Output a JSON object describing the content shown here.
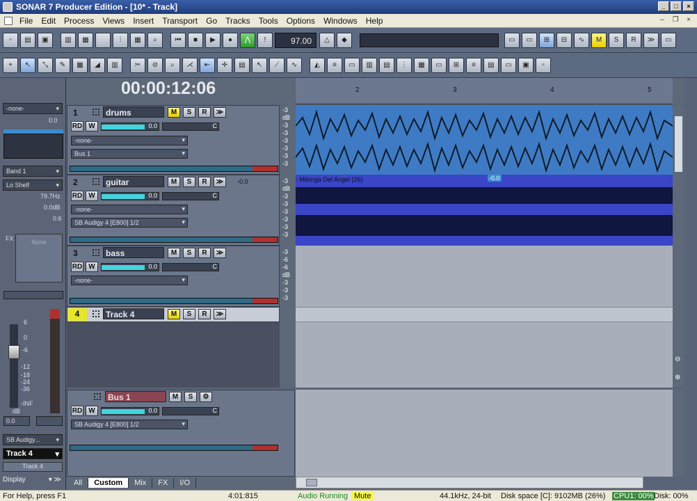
{
  "window": {
    "title": "SONAR 7 Producer Edition - [10* - Track]"
  },
  "menu": [
    "File",
    "Edit",
    "Process",
    "Views",
    "Insert",
    "Transport",
    "Go",
    "Tracks",
    "Tools",
    "Options",
    "Windows",
    "Help"
  ],
  "transport": {
    "tempo": "97.00",
    "time": "00:00:12:06"
  },
  "ruler": {
    "marks": [
      "2",
      "3",
      "4",
      "5"
    ]
  },
  "left_panel": {
    "top_select": "-none-",
    "top_value": "0.0",
    "eq_band": "Band 1",
    "eq_type": "Lo Shelf",
    "eq_freq": "79.7Hz",
    "eq_gain": "0.0dB",
    "eq_q": "0.6",
    "fx_label": "FX",
    "fx_none": "None",
    "fader_scale": [
      "6",
      "0",
      "-6",
      "-12",
      "-18",
      "-24",
      "-36",
      "-INF"
    ],
    "fader_value": "0.0",
    "db_label": "dB",
    "output": "SB Audigy...",
    "track_name_sel": "Track 4",
    "track_name": "Track 4",
    "display": "Display"
  },
  "tracks": [
    {
      "num": "1",
      "name": "drums",
      "vol": "0.0",
      "pan": "C",
      "input": "-none-",
      "output": "Bus 1",
      "mute_on": true
    },
    {
      "num": "2",
      "name": "guitar",
      "vol": "0.0",
      "pan": "C",
      "input": "-none-",
      "output": "SB Audigy 4 [E800] 1/2",
      "gain": "-0.0",
      "mute_on": false
    },
    {
      "num": "3",
      "name": "bass",
      "vol": "0.0",
      "pan": "C",
      "input": "-none-",
      "output": "",
      "mute_on": false
    },
    {
      "num": "4",
      "name": "Track 4",
      "mute_on": true
    }
  ],
  "clip": {
    "label": "- Milonga Del Angel (26)",
    "marker": "-0.0"
  },
  "bus": {
    "name": "Bus 1",
    "vol": "0.0",
    "pan": "C",
    "output": "SB Audigy 4 [E800] 1/2"
  },
  "meter_scale": {
    "a": "-3",
    "b": "dB",
    "c": "-3",
    "d": "-6"
  },
  "tabs": [
    "All",
    "Custom",
    "Mix",
    "FX",
    "I/O"
  ],
  "status": {
    "help": "For Help, press F1",
    "pos": "4:01:815",
    "audio": "Audio Running",
    "mute": "Mute",
    "rate": "44.1kHz, 24-bit",
    "disk": "Disk space [C]: 9102MB (26%)",
    "cpu": "CPU1: 00%",
    "disk2": "Disk: 00%"
  },
  "colors": {
    "clip_blue": "#3e7bc4",
    "clip_dark": "#3a45c8",
    "accent": "#e6d100"
  }
}
